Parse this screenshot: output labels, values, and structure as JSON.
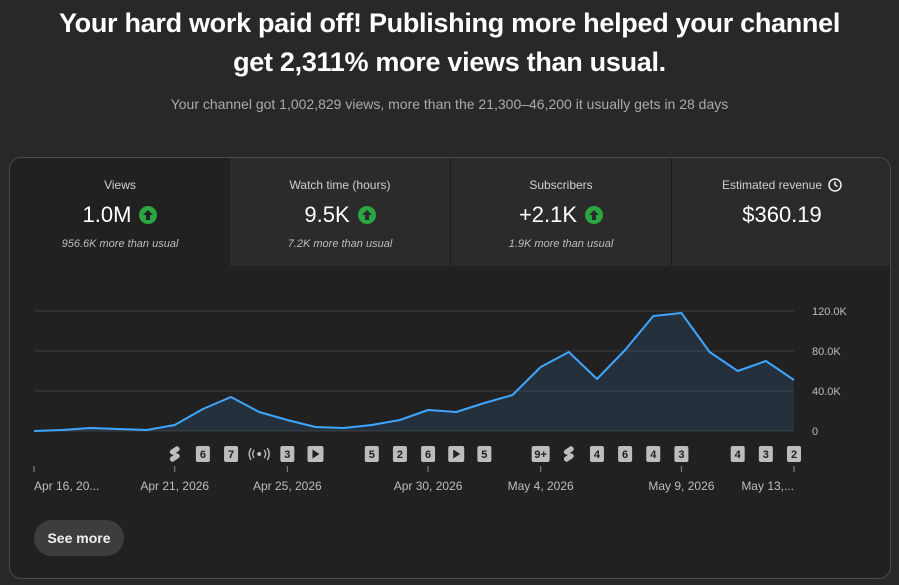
{
  "headline": {
    "line1": "Your hard work paid off! Publishing more helped your channel",
    "line2": "get 2,311% more views than usual."
  },
  "subline": "Your channel got 1,002,829 views, more than the 21,300–46,200 it usually gets in 28 days",
  "metrics": [
    {
      "label": "Views",
      "value": "1.0M",
      "note": "956.6K more than usual",
      "trend": "up"
    },
    {
      "label": "Watch time (hours)",
      "value": "9.5K",
      "note": "7.2K more than usual",
      "trend": "up"
    },
    {
      "label": "Subscribers",
      "value": "+2.1K",
      "note": "1.9K more than usual",
      "trend": "up"
    },
    {
      "label": "Estimated revenue",
      "value": "$360.19",
      "note": "",
      "icon": "clock-icon"
    }
  ],
  "see_more_label": "See more",
  "colors": {
    "line": "#3ea6ff",
    "up": "#2ba640"
  },
  "chart_data": {
    "type": "area",
    "x_tick_labels": [
      "Apr 16, 20...",
      "Apr 21, 2026",
      "Apr 25, 2026",
      "Apr 30, 2026",
      "May 4, 2026",
      "May 9, 2026",
      "May 13,..."
    ],
    "y_tick_labels": [
      "0",
      "40.0K",
      "80.0K",
      "120.0K"
    ],
    "ylim": [
      0,
      140000
    ],
    "grid": true,
    "values": [
      0,
      1000,
      3000,
      2000,
      1000,
      6000,
      22000,
      34000,
      19000,
      11000,
      4000,
      3000,
      6000,
      11000,
      21000,
      19000,
      28000,
      36000,
      64000,
      79000,
      52000,
      81000,
      115000,
      118000,
      79000,
      60000,
      70000,
      51000
    ],
    "markers": [
      {
        "day": 5,
        "label": "",
        "icon": "shorts-icon"
      },
      {
        "day": 6,
        "label": "6"
      },
      {
        "day": 7,
        "label": "7"
      },
      {
        "day": 8,
        "label": "",
        "icon": "live-icon"
      },
      {
        "day": 9,
        "label": "3"
      },
      {
        "day": 10,
        "label": "",
        "icon": "video-icon"
      },
      {
        "day": 12,
        "label": "5"
      },
      {
        "day": 13,
        "label": "2"
      },
      {
        "day": 14,
        "label": "6"
      },
      {
        "day": 15,
        "label": "",
        "icon": "video-icon"
      },
      {
        "day": 16,
        "label": "5"
      },
      {
        "day": 18,
        "label": "9+"
      },
      {
        "day": 19,
        "label": "",
        "icon": "shorts-icon"
      },
      {
        "day": 20,
        "label": "4"
      },
      {
        "day": 21,
        "label": "6"
      },
      {
        "day": 22,
        "label": "4"
      },
      {
        "day": 23,
        "label": "3"
      },
      {
        "day": 25,
        "label": "4"
      },
      {
        "day": 26,
        "label": "3"
      },
      {
        "day": 27,
        "label": "2"
      }
    ]
  }
}
